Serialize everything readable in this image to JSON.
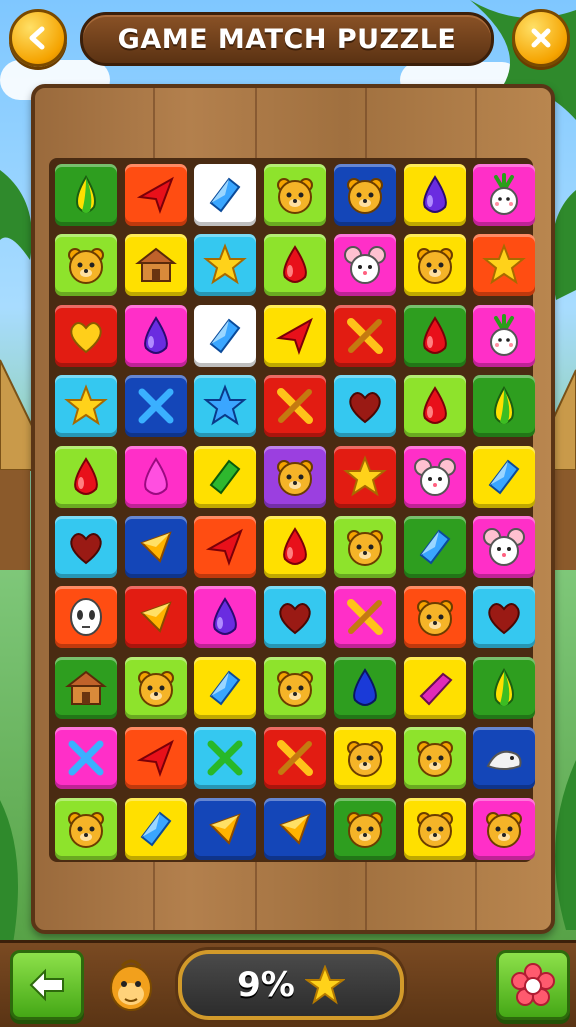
{
  "header": {
    "title": "GAME MATCH PUZZLE",
    "back_icon": "back-chevron-icon",
    "close_icon": "close-x-icon"
  },
  "board": {
    "rows": 10,
    "cols": 7,
    "tiles": [
      [
        [
          "#2e9e1f",
          "drop-yg"
        ],
        [
          "#ff4d12",
          "plane-red"
        ],
        [
          "#ffffff",
          "diamond-blue"
        ],
        [
          "#8ee32c",
          "bear"
        ],
        [
          "#1446b8",
          "bear"
        ],
        [
          "#ffe000",
          "drop-purple"
        ],
        [
          "#ff2fc8",
          "radish"
        ]
      ],
      [
        [
          "#8ee32c",
          "bear"
        ],
        [
          "#ffe000",
          "hut"
        ],
        [
          "#35c8f0",
          "star"
        ],
        [
          "#8ee32c",
          "drop-red"
        ],
        [
          "#ff2fc8",
          "mouse"
        ],
        [
          "#ffe000",
          "bear"
        ],
        [
          "#ff4d12",
          "star"
        ]
      ],
      [
        [
          "#e21c12",
          "heart-yellow"
        ],
        [
          "#ff2fc8",
          "drop-purple"
        ],
        [
          "#ffffff",
          "diamond-blue"
        ],
        [
          "#ffe000",
          "plane-red"
        ],
        [
          "#e21c12",
          "cross-yellow"
        ],
        [
          "#2e9e1f",
          "drop-red"
        ],
        [
          "#ff2fc8",
          "radish"
        ]
      ],
      [
        [
          "#35c8f0",
          "star"
        ],
        [
          "#1446b8",
          "cross-blue"
        ],
        [
          "#35c8f0",
          "star-blue"
        ],
        [
          "#e21c12",
          "cross-yellow"
        ],
        [
          "#35c8f0",
          "heart-red"
        ],
        [
          "#8ee32c",
          "drop-red"
        ],
        [
          "#2e9e1f",
          "drop-yg"
        ]
      ],
      [
        [
          "#8ee32c",
          "drop-red"
        ],
        [
          "#ff2fc8",
          "drop-pink"
        ],
        [
          "#ffe000",
          "diamond-green"
        ],
        [
          "#9b3fe0",
          "bear"
        ],
        [
          "#e21c12",
          "star"
        ],
        [
          "#ff2fc8",
          "mouse"
        ],
        [
          "#ffe000",
          "diamond-blue"
        ]
      ],
      [
        [
          "#35c8f0",
          "heart-red"
        ],
        [
          "#1446b8",
          "diamond-orange"
        ],
        [
          "#ff4d12",
          "plane-red"
        ],
        [
          "#ffe000",
          "drop-red"
        ],
        [
          "#8ee32c",
          "bear"
        ],
        [
          "#2e9e1f",
          "diamond-blue"
        ],
        [
          "#ff2fc8",
          "mouse"
        ]
      ],
      [
        [
          "#ff4d12",
          "skull"
        ],
        [
          "#e21c12",
          "diamond-orange"
        ],
        [
          "#ff2fc8",
          "drop-purple"
        ],
        [
          "#35c8f0",
          "heart-red"
        ],
        [
          "#ff2fc8",
          "cross-yellow"
        ],
        [
          "#ff4d12",
          "bear"
        ],
        [
          "#35c8f0",
          "heart-red"
        ]
      ],
      [
        [
          "#2e9e1f",
          "hut"
        ],
        [
          "#8ee32c",
          "bear"
        ],
        [
          "#ffe000",
          "diamond-blue"
        ],
        [
          "#8ee32c",
          "bear"
        ],
        [
          "#2e9e1f",
          "drop-blue"
        ],
        [
          "#ffe000",
          "diamond-pink"
        ],
        [
          "#2e9e1f",
          "drop-yg"
        ]
      ],
      [
        [
          "#ff2fc8",
          "cross-blue"
        ],
        [
          "#ff4d12",
          "plane-red"
        ],
        [
          "#35c8f0",
          "cross-green"
        ],
        [
          "#e21c12",
          "cross-yellow"
        ],
        [
          "#ffe000",
          "bear"
        ],
        [
          "#8ee32c",
          "bear"
        ],
        [
          "#1446b8",
          "fish"
        ]
      ],
      [
        [
          "#8ee32c",
          "bear"
        ],
        [
          "#ffe000",
          "diamond-blue"
        ],
        [
          "#1446b8",
          "diamond-orange"
        ],
        [
          "#1446b8",
          "diamond-orange"
        ],
        [
          "#2e9e1f",
          "bear"
        ],
        [
          "#ffe000",
          "bear"
        ],
        [
          "#ff2fc8",
          "bear"
        ]
      ]
    ]
  },
  "footer": {
    "back_icon": "left-arrow-icon",
    "progress_percent": 9,
    "progress_text": "9%",
    "star_icon": "star-icon",
    "character_icon": "monkey-icon",
    "settings_icon": "flower-gear-icon"
  },
  "colors": {
    "button_gold": "#f5a300",
    "button_green": "#45a816",
    "wood": "#a0703f"
  }
}
